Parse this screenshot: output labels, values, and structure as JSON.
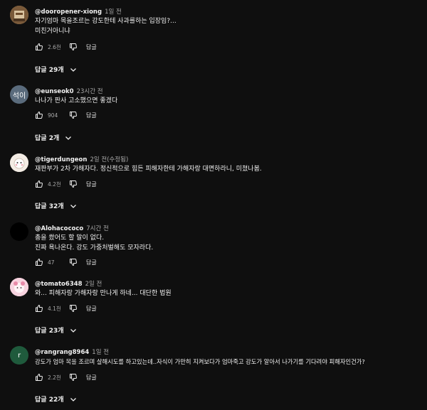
{
  "comments": [
    {
      "author": "@dooropener-xiong",
      "time": "1일 전",
      "lines": [
        "자기엄마 목을조르는 강도한테 사과를하는 입장임?...",
        "미친거아니냐"
      ],
      "likes": "2.6천",
      "reply_label": "답글",
      "replies_label": "답글 29개",
      "avatar_text": "",
      "avatar_color": "#b08a5a"
    },
    {
      "author": "@eunseok0",
      "time": "23시간 전",
      "lines": [
        "나나가 판사 고소했으면 좋겠다"
      ],
      "likes": "904",
      "reply_label": "답글",
      "replies_label": "답글 2개",
      "avatar_text": "석이",
      "avatar_color": "#5a6b7c"
    },
    {
      "author": "@tigerdungeon",
      "time": "2일 전(수정됨)",
      "lines": [
        "재판부가 2차 가해자다. 정신적으로 힘든 피해자한테 가해자랑 대면하라니, 미쳤나봄."
      ],
      "likes": "4.2천",
      "reply_label": "답글",
      "replies_label": "답글 32개",
      "avatar_text": "",
      "avatar_color": "#e8dcd0"
    },
    {
      "author": "@Alohacococo",
      "time": "7시간 전",
      "lines": [
        "총을 쐈어도 할 말이 없다.",
        "진짜 욕나온다. 강도 가중처벌해도 모자라다."
      ],
      "likes": "47",
      "reply_label": "답글",
      "replies_label": "",
      "avatar_text": "",
      "avatar_color": "#000000"
    },
    {
      "author": "@tomato6348",
      "time": "2일 전",
      "lines": [
        "와... 피해자랑 가해자랑 만나게 하네... 대단한 법원"
      ],
      "likes": "4.1천",
      "reply_label": "답글",
      "replies_label": "답글 23개",
      "avatar_text": "",
      "avatar_color": "#f4c6d6"
    },
    {
      "author": "@rangrang8964",
      "time": "1일 전",
      "lines": [
        "강도가 엄마 목을 조르며 살해시도를 하고있는데..자식이 가만히 지켜보다가 엄마죽고 강도가 알아서 나가기를 기다려야 피해자인건가?"
      ],
      "likes": "2.2천",
      "reply_label": "답글",
      "replies_label": "답글 22개",
      "avatar_text": "r",
      "avatar_color": "#1f5a3c"
    }
  ]
}
